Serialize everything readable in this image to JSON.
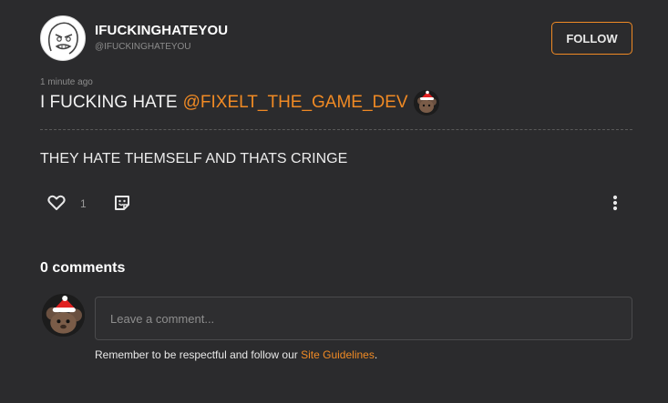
{
  "author": {
    "name": "IFUCKINGHATEYOU",
    "handle": "@IFUCKINGHATEYOU",
    "follow_label": "FOLLOW"
  },
  "post": {
    "timestamp": "1 minute ago",
    "title_prefix": "I FUCKING HATE",
    "mention": "@FIXELT_THE_GAME_DEV",
    "body": "THEY HATE THEMSELF AND THATS CRINGE",
    "like_count": "1"
  },
  "comments": {
    "heading": "0 comments",
    "placeholder": "Leave a comment...",
    "guidelines_prefix": "Remember to be respectful and follow our ",
    "guidelines_link": "Site Guidelines",
    "guidelines_suffix": "."
  },
  "colors": {
    "accent": "#f08a24",
    "background": "#2b2b2d"
  },
  "icons": [
    "rage-face-avatar-icon",
    "bear-santa-hat-avatar-icon",
    "heart-icon",
    "reaction-sticker-icon",
    "more-vertical-icon"
  ]
}
